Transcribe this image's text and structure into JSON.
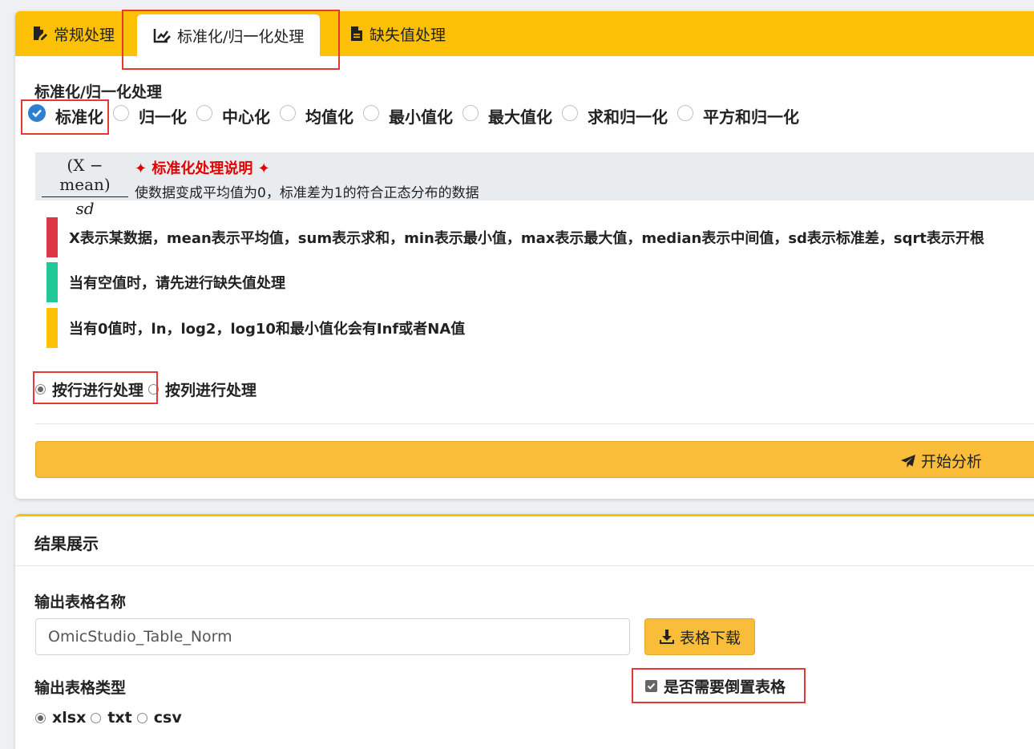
{
  "tabs": [
    {
      "label": "常规处理",
      "icon": "file-edit-icon"
    },
    {
      "label": "标准化/归一化处理",
      "icon": "chart-edit-icon",
      "active": true
    },
    {
      "label": "缺失值处理",
      "icon": "file-icon"
    }
  ],
  "method_section": {
    "title": "标准化/归一化处理",
    "options": [
      "标准化",
      "归一化",
      "中心化",
      "均值化",
      "最小值化",
      "最大值化",
      "求和归一化",
      "平方和归一化"
    ],
    "selected": "标准化"
  },
  "formula": {
    "numerator": "(X − mean)",
    "denominator": "sd",
    "title": "✦ 标准化处理说明 ✦",
    "description": "使数据变成平均值为0，标准差为1的符合正态分布的数据"
  },
  "notes": [
    {
      "text": "X表示某数据，mean表示平均值，sum表示求和，min表示最小值，max表示最大值，median表示中间值，sd表示标准差，sqrt表示开根",
      "color": "#dc3545"
    },
    {
      "text": "当有空值时，请先进行缺失值处理",
      "color": "#20c997"
    },
    {
      "text": "当有0值时，ln，log2，log10和最小值化会有Inf或者NA值",
      "color": "#ffc107"
    }
  ],
  "direction": {
    "options": [
      "按行进行处理",
      "按列进行处理"
    ],
    "selected": "按行进行处理"
  },
  "start_button": {
    "label": "开始分析"
  },
  "results": {
    "title": "结果展示",
    "name_label": "输出表格名称",
    "name_value": "OmicStudio_Table_Norm",
    "download_label": "表格下载",
    "type_label": "输出表格类型",
    "type_options": [
      "xlsx",
      "txt",
      "csv"
    ],
    "type_selected": "xlsx",
    "transpose_label": "是否需要倒置表格",
    "transpose_checked": true
  },
  "colors": {
    "accent": "#fcc107",
    "button": "#f9bd3a",
    "highlight": "#e53935",
    "check": "#2f7fd1"
  }
}
